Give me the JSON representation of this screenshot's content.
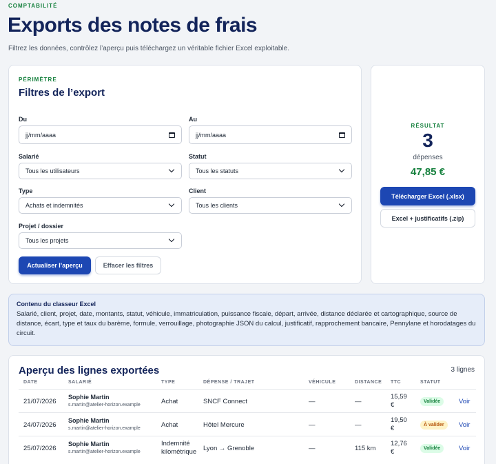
{
  "header": {
    "eyebrow": "COMPTABILITÉ",
    "title": "Exports des notes de frais",
    "subtitle": "Filtrez les données, contrôlez l’aperçu puis téléchargez un véritable fichier Excel exploitable."
  },
  "filters": {
    "eyebrow": "PÉRIMÈTRE",
    "title": "Filtres de l’export",
    "from": {
      "label": "Du",
      "placeholder": "jj/mm/aaaa"
    },
    "to": {
      "label": "Au",
      "placeholder": "jj/mm/aaaa"
    },
    "employee": {
      "label": "Salarié",
      "value": "Tous les utilisateurs"
    },
    "status": {
      "label": "Statut",
      "value": "Tous les statuts"
    },
    "type": {
      "label": "Type",
      "value": "Achats et indemnités"
    },
    "client": {
      "label": "Client",
      "value": "Tous les clients"
    },
    "project": {
      "label": "Projet / dossier",
      "value": "Tous les projets"
    },
    "refresh_label": "Actualiser l’aperçu",
    "clear_label": "Effacer les filtres"
  },
  "result": {
    "eyebrow": "RÉSULTAT",
    "count": "3",
    "unit": "dépenses",
    "total": "47,85 €",
    "download_excel": "Télécharger Excel (.xlsx)",
    "download_zip": "Excel + justificatifs (.zip)"
  },
  "info": {
    "title": "Contenu du classeur Excel",
    "body": "Salarié, client, projet, date, montants, statut, véhicule, immatriculation, puissance fiscale, départ, arrivée, distance déclarée et cartographique, source de distance, écart, type et taux du barème, formule, verrouillage, photographie JSON du calcul, justificatif, rapprochement bancaire, Pennylane et horodatages du circuit."
  },
  "preview": {
    "title": "Aperçu des lignes exportées",
    "count": "3 lignes",
    "columns": [
      "DATE",
      "SALARIÉ",
      "TYPE",
      "DÉPENSE / TRAJET",
      "VÉHICULE",
      "DISTANCE",
      "TTC",
      "STATUT"
    ],
    "rows": [
      {
        "date": "21/07/2026",
        "name": "Sophie Martin",
        "email": "s.martin@atelier-horizon.example",
        "type": "Achat",
        "expense": "SNCF Connect",
        "vehicle": "—",
        "distance": "—",
        "ttc": "15,59 €",
        "status": "Validée",
        "action": "Voir"
      },
      {
        "date": "24/07/2026",
        "name": "Sophie Martin",
        "email": "s.martin@atelier-horizon.example",
        "type": "Achat",
        "expense": "Hôtel Mercure",
        "vehicle": "—",
        "distance": "—",
        "ttc": "19,50 €",
        "status": "À valider",
        "action": "Voir"
      },
      {
        "date": "25/07/2026",
        "name": "Sophie Martin",
        "email": "s.martin@atelier-horizon.example",
        "type": "Indemnité kilométrique",
        "expense": "Lyon → Grenoble",
        "vehicle": "—",
        "distance": "115 km",
        "ttc": "12,76 €",
        "status": "Validée",
        "action": "Voir"
      }
    ]
  }
}
